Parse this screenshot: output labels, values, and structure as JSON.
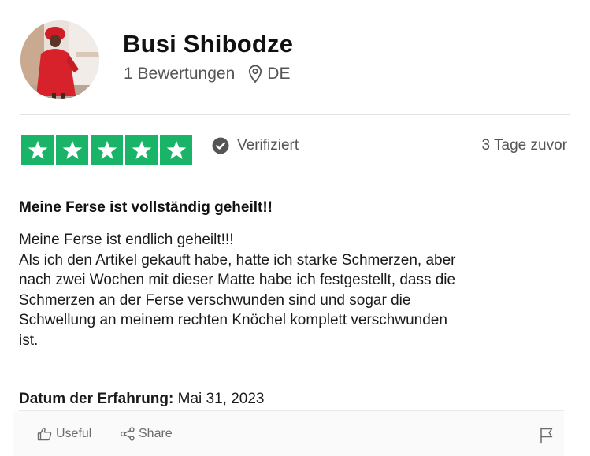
{
  "reviewer": {
    "name": "Busi Shibodze",
    "review_count": "1 Bewertungen",
    "country": "DE"
  },
  "rating": {
    "stars": 5,
    "verified_label": "Verifiziert",
    "posted_ago": "3 Tage zuvor",
    "star_color": "#1ab469"
  },
  "review": {
    "title": "Meine Ferse ist vollständig geheilt!!",
    "body_lines": [
      "Meine Ferse ist endlich geheilt!!!",
      "Als ich den Artikel gekauft habe, hatte ich starke Schmerzen, aber",
      "nach zwei Wochen mit dieser Matte habe ich festgestellt, dass die",
      "Schmerzen an der Ferse verschwunden sind und sogar die",
      "Schwellung an meinem rechten Knöchel komplett verschwunden",
      "ist."
    ],
    "experience_label": "Datum der Erfahrung:",
    "experience_date": "Mai 31, 2023"
  },
  "actions": {
    "useful_label": "Useful",
    "share_label": "Share"
  },
  "icons": {
    "location": "location-pin-icon",
    "verified": "check-circle-icon",
    "useful": "thumbs-up-icon",
    "share": "share-icon",
    "report": "flag-icon"
  }
}
